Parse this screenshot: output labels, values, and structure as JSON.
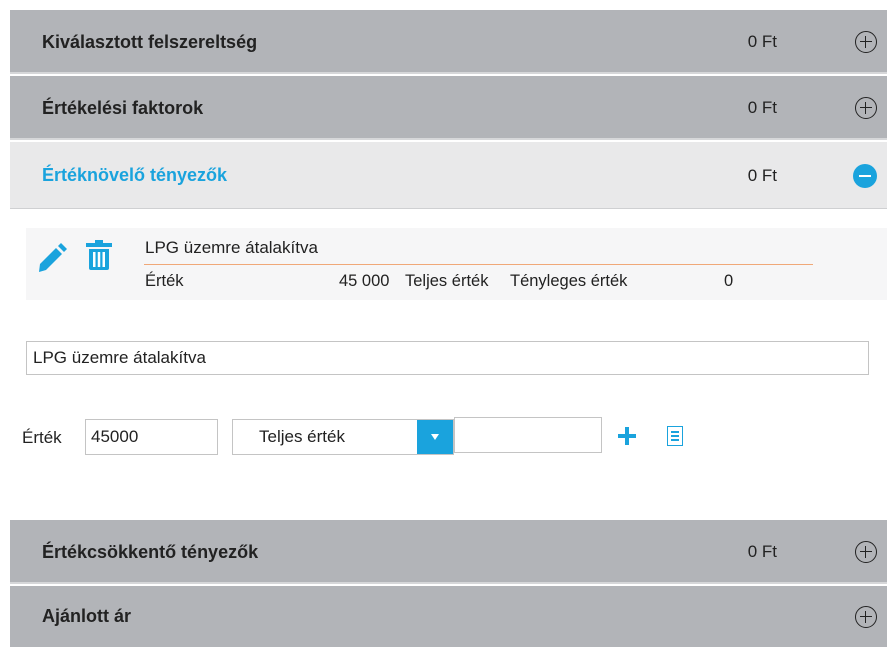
{
  "sections": [
    {
      "title": "Kiválasztott felszereltség",
      "amount": "0 Ft",
      "expanded": false
    },
    {
      "title": "Értékelési faktorok",
      "amount": "0 Ft",
      "expanded": false
    },
    {
      "title": "Értéknövelő tényezők",
      "amount": "0 Ft",
      "expanded": true
    },
    {
      "title": "Értékcsökkentő tényezők",
      "amount": "0 Ft",
      "expanded": false
    },
    {
      "title": "Ajánlott ár",
      "amount": "",
      "expanded": false
    }
  ],
  "item": {
    "name": "LPG üzemre átalakítva",
    "value_label": "Érték",
    "value": "45 000",
    "total_label": "Teljes érték",
    "actual_label": "Tényleges érték",
    "actual_value": "0",
    "edit_icon": "pencil-icon",
    "delete_icon": "trash-icon"
  },
  "form": {
    "name_value": "LPG üzemre átalakítva",
    "value_label": "Érték",
    "value_input": "45000",
    "type_selected": "Teljes érték",
    "extra_value": "",
    "add_icon": "plus-icon",
    "list_icon": "list-icon"
  },
  "colors": {
    "accent": "#1aa3dd",
    "header_bg": "#b2b4b8",
    "active_header_bg": "#e9e9ea",
    "underline": "#f0a878"
  }
}
